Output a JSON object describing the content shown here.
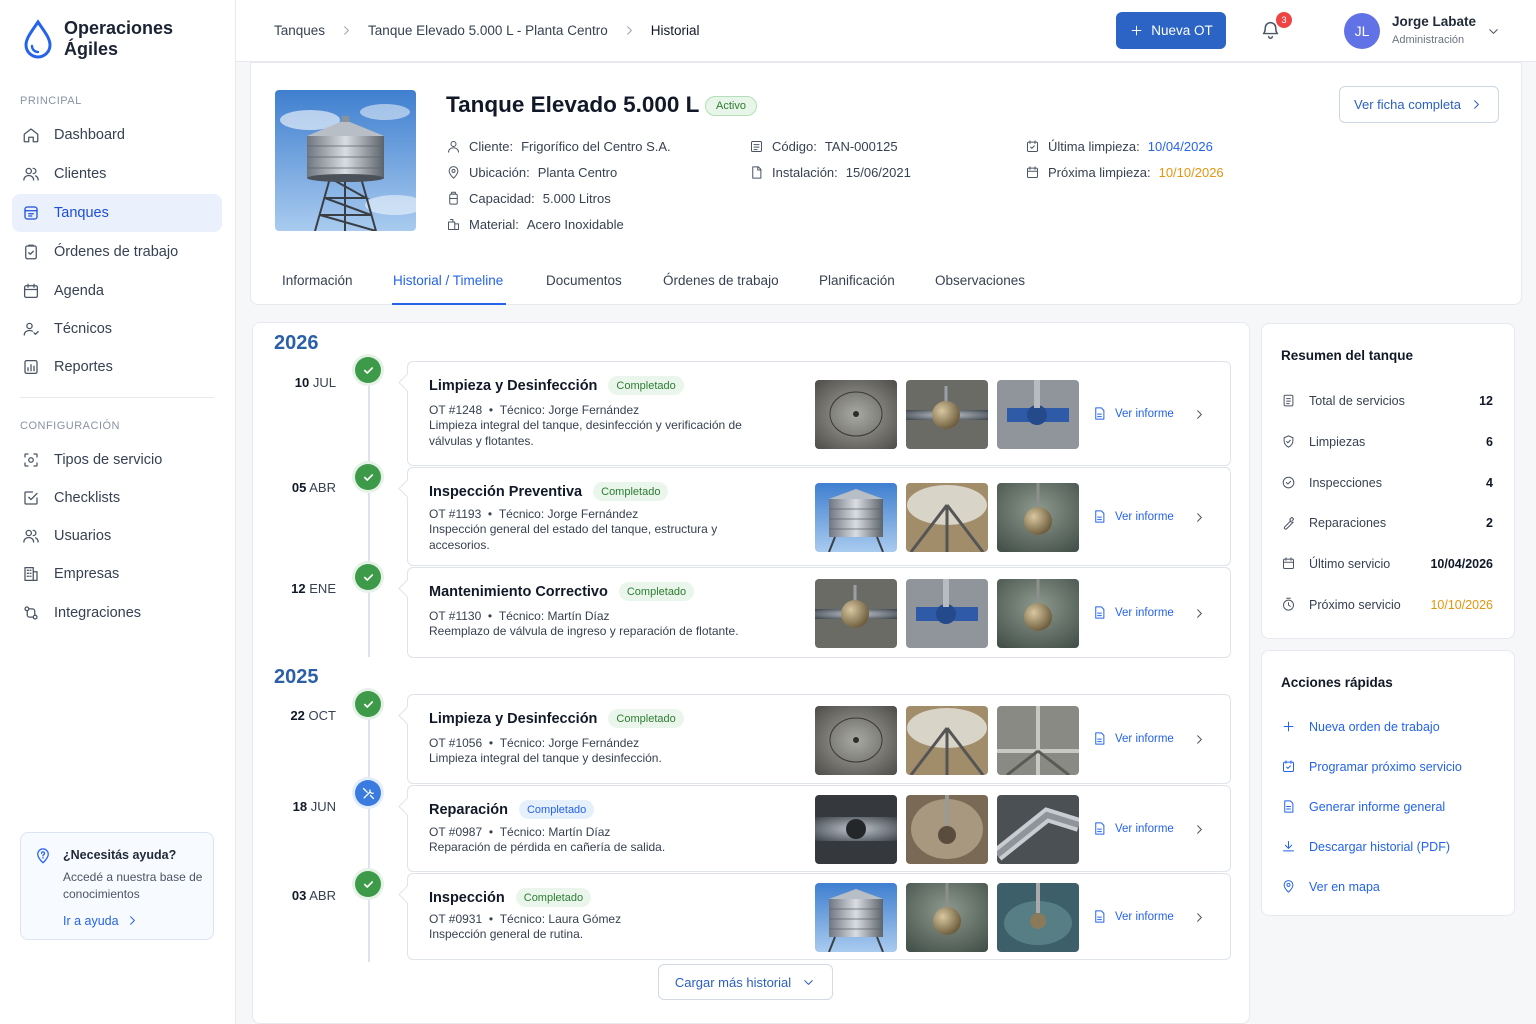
{
  "app": {
    "name": "Operaciones Ágiles",
    "colors": {
      "primary": "#2b64c4",
      "success": "#3d9a48",
      "warning": "#e5950f",
      "accent_link": "#2563eb"
    }
  },
  "sidebar": {
    "section_principal": "PRINCIPAL",
    "items": [
      {
        "label": "Dashboard",
        "icon": "home-icon"
      },
      {
        "label": "Clientes",
        "icon": "users-icon"
      },
      {
        "label": "Tanques",
        "icon": "tank-icon",
        "active": true
      },
      {
        "label": "Órdenes de trabajo",
        "icon": "clipboard-icon"
      },
      {
        "label": "Agenda",
        "icon": "calendar-icon"
      },
      {
        "label": "Técnicos",
        "icon": "technician-icon"
      },
      {
        "label": "Reportes",
        "icon": "report-icon"
      }
    ],
    "section_config": "CONFIGURACIÓN",
    "config_items": [
      {
        "label": "Tipos de servicio",
        "icon": "service-types-icon"
      },
      {
        "label": "Checklists",
        "icon": "checklist-icon"
      },
      {
        "label": "Usuarios",
        "icon": "users-icon"
      },
      {
        "label": "Empresas",
        "icon": "building-icon"
      },
      {
        "label": "Integraciones",
        "icon": "integrations-icon"
      }
    ],
    "help": {
      "title": "¿Necesitás ayuda?",
      "desc": "Accedé a nuestra base de conocimientos",
      "link": "Ir a ayuda"
    }
  },
  "topbar": {
    "breadcrumb": [
      "Tanques",
      "Tanque Elevado 5.000 L - Planta Centro",
      "Historial"
    ],
    "new_button": "Nueva OT",
    "notifications": "3",
    "user": {
      "initials": "JL",
      "name": "Jorge Labate",
      "role": "Administración"
    }
  },
  "tank": {
    "title": "Tanque Elevado 5.000 L",
    "status": "Activo",
    "full_sheet_button": "Ver ficha completa",
    "client_label": "Cliente:",
    "client": "Frigorífico del Centro S.A.",
    "location_label": "Ubicación:",
    "location": "Planta Centro",
    "capacity_label": "Capacidad:",
    "capacity": "5.000 Litros",
    "material_label": "Material:",
    "material": "Acero Inoxidable",
    "code_label": "Código:",
    "code": "TAN-000125",
    "install_label": "Instalación:",
    "install": "15/06/2021",
    "last_clean_label": "Última limpieza:",
    "last_clean": "10/04/2026",
    "next_clean_label": "Próxima limpieza:",
    "next_clean": "10/10/2026"
  },
  "tabs": [
    "Información",
    "Historial / Timeline",
    "Documentos",
    "Órdenes de trabajo",
    "Planificación",
    "Observaciones"
  ],
  "active_tab": "Historial / Timeline",
  "timeline": {
    "years": [
      "2026",
      "2025"
    ],
    "report_label": "Ver informe",
    "events": [
      {
        "day": "10",
        "month": "JUL",
        "title": "Limpieza y Desinfección",
        "status": "Completado",
        "ot": "OT #1248",
        "tech_label": "Técnico:",
        "tech": "Jorge Fernández",
        "desc": "Limpieza integral del tanque, desinfección y verificación de válvulas y flotantes.",
        "icon": "check-icon"
      },
      {
        "day": "05",
        "month": "ABR",
        "title": "Inspección Preventiva",
        "status": "Completado",
        "ot": "OT #1193",
        "tech_label": "Técnico:",
        "tech": "Jorge Fernández",
        "desc": "Inspección general del estado del tanque, estructura y accesorios.",
        "icon": "check-icon"
      },
      {
        "day": "12",
        "month": "ENE",
        "title": "Mantenimiento Correctivo",
        "status": "Completado",
        "ot": "OT #1130",
        "tech_label": "Técnico:",
        "tech": "Martín Díaz",
        "desc": "Reemplazo de válvula de ingreso y reparación de flotante.",
        "icon": "check-icon"
      },
      {
        "day": "22",
        "month": "OCT",
        "title": "Limpieza y Desinfección",
        "status": "Completado",
        "ot": "OT #1056",
        "tech_label": "Técnico:",
        "tech": "Jorge Fernández",
        "desc": "Limpieza integral del tanque y desinfección.",
        "icon": "check-icon"
      },
      {
        "day": "18",
        "month": "JUN",
        "title": "Reparación",
        "status": "Completado",
        "ot": "OT #0987",
        "tech_label": "Técnico:",
        "tech": "Martín Díaz",
        "desc": "Reparación de pérdida en cañería de salida.",
        "icon": "wrench-icon"
      },
      {
        "day": "03",
        "month": "ABR",
        "title": "Inspección",
        "status": "Completado",
        "ot": "OT #0931",
        "tech_label": "Técnico:",
        "tech": "Laura Gómez",
        "desc": "Inspección general de rutina.",
        "icon": "check-icon"
      }
    ],
    "load_more": "Cargar más historial"
  },
  "summary": {
    "title": "Resumen del tanque",
    "rows": [
      {
        "label": "Total de servicios",
        "value": "12"
      },
      {
        "label": "Limpiezas",
        "value": "6"
      },
      {
        "label": "Inspecciones",
        "value": "4"
      },
      {
        "label": "Reparaciones",
        "value": "2"
      },
      {
        "label": "Último servicio",
        "value": "10/04/2026"
      },
      {
        "label": "Próximo servicio",
        "value": "10/10/2026"
      }
    ]
  },
  "quick_actions": {
    "title": "Acciones rápidas",
    "items": [
      "Nueva orden de trabajo",
      "Programar próximo servicio",
      "Generar informe general",
      "Descargar historial (PDF)",
      "Ver en mapa"
    ]
  }
}
